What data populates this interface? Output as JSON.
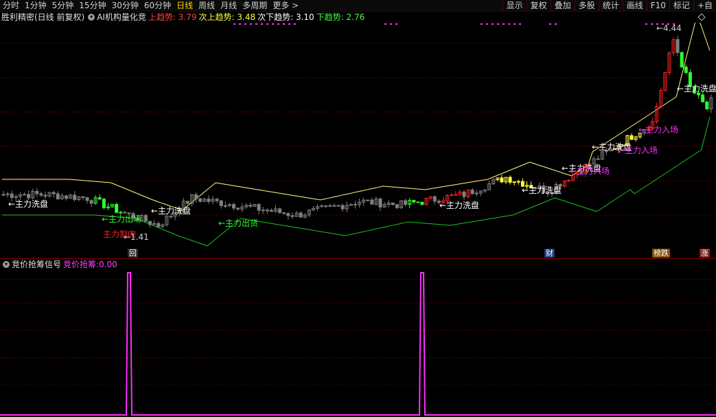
{
  "toolbar": {
    "periods": [
      "分时",
      "1分钟",
      "5分钟",
      "15分钟",
      "30分钟",
      "60分钟",
      "日线",
      "周线",
      "月线",
      "多周期",
      "更多 >"
    ],
    "active_period": "日线",
    "right_tools": [
      "显示",
      "复权",
      "叠加",
      "多股",
      "统计",
      "画线",
      "F10",
      "标记",
      "+自"
    ]
  },
  "main_panel": {
    "title": "胜利精密(日线 前复权)",
    "indicator": "AI机构量化竞",
    "indicator_values": [
      {
        "label": "上趋势: ",
        "value": "3.79",
        "color": "#ff4040"
      },
      {
        "label": "次上趋势: ",
        "value": "3.48",
        "color": "#ffff40"
      },
      {
        "label": "次下趋势: ",
        "value": "3.10",
        "color": "#ffffff"
      },
      {
        "label": "下趋势: ",
        "value": "2.76",
        "color": "#40ff40"
      }
    ],
    "high_label": "4.44",
    "low_label": "1.41",
    "annotations": {
      "wash": "主力洗盘",
      "enter": "主力入场",
      "exit": "主力出场",
      "exit2": "主力出货",
      "cut": "主力割肉",
      "wash2": "主力洗盘"
    },
    "markers": [
      {
        "text": "回",
        "color": "#ffffff",
        "bg": "#2a2a2a"
      },
      {
        "text": "财",
        "color": "#ffffff",
        "bg": "#1f3a80"
      },
      {
        "text": "榜跌",
        "color": "#ffffff",
        "bg": "#805000"
      },
      {
        "text": "涨",
        "color": "#ffffff",
        "bg": "#802020"
      }
    ]
  },
  "sub_panel": {
    "title": "竞价抢筹信号",
    "value_label": "竞价抢筹: ",
    "value": "0.00",
    "value_color": "#ff40ff",
    "signals": [
      {
        "index": 36
      },
      {
        "index": 118
      }
    ]
  },
  "colors": {
    "up": "#ff2020",
    "yellow": "#ffff40",
    "green": "#30ff30",
    "gray": "#808080",
    "white_candle": "#d8d8d8",
    "upper_band": "#ffff80",
    "lower_band": "#20c020",
    "magenta": "#ff30ff",
    "grid": "#6a0000"
  }
}
